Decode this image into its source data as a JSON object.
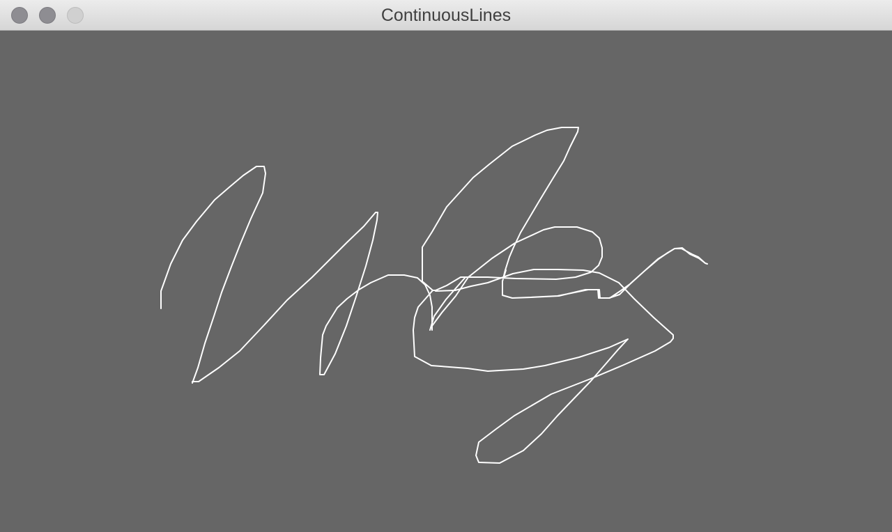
{
  "window": {
    "title": "ContinuousLines",
    "buttons": {
      "close": "close-button",
      "minimize": "minimize-button",
      "zoom": "zoom-button"
    }
  },
  "canvas": {
    "background_color": "#666666",
    "stroke_color": "#ffffff"
  }
}
